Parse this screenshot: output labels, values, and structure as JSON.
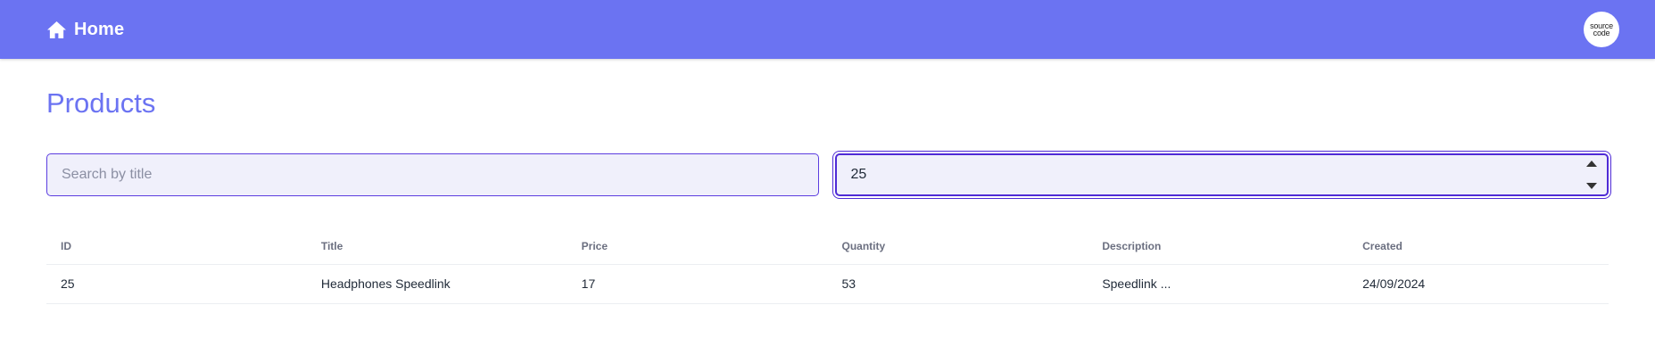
{
  "header": {
    "home_label": "Home",
    "home_icon": "home-icon",
    "logo_line1": "source",
    "logo_line2": "code"
  },
  "page": {
    "title": "Products"
  },
  "filters": {
    "search_placeholder": "Search by title",
    "search_value": "",
    "quantity_value": "25"
  },
  "table": {
    "columns": [
      "ID",
      "Title",
      "Price",
      "Quantity",
      "Description",
      "Created"
    ],
    "rows": [
      {
        "id": "25",
        "title": "Headphones Speedlink",
        "price": "17",
        "quantity": "53",
        "description": "Speedlink ...",
        "created": "24/09/2024"
      }
    ]
  },
  "colors": {
    "accent": "#6b73f2",
    "focus_border": "#4f2bd6",
    "input_bg": "#f0f0fb"
  }
}
